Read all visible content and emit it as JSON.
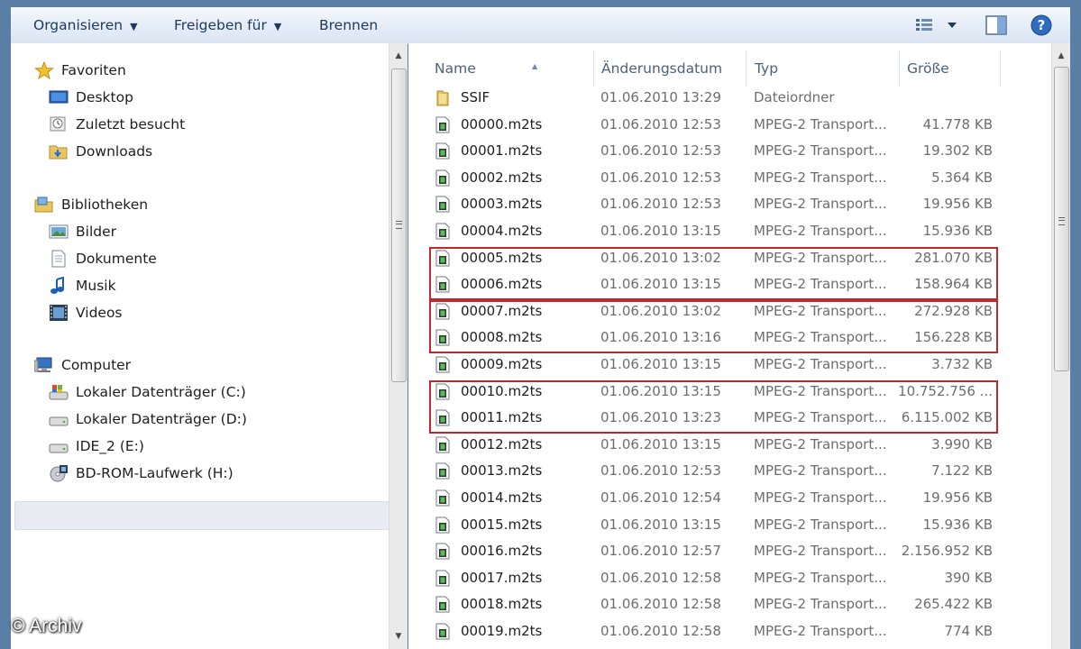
{
  "toolbar": {
    "organize": "Organisieren",
    "share": "Freigeben für",
    "burn": "Brennen"
  },
  "nav": {
    "favorites": {
      "label": "Favoriten",
      "items": [
        "Desktop",
        "Zuletzt besucht",
        "Downloads"
      ]
    },
    "libraries": {
      "label": "Bibliotheken",
      "items": [
        "Bilder",
        "Dokumente",
        "Musik",
        "Videos"
      ]
    },
    "computer": {
      "label": "Computer",
      "items": [
        "Lokaler Datenträger (C:)",
        "Lokaler Datenträger (D:)",
        "IDE_2 (E:)",
        "BD-ROM-Laufwerk (H:)"
      ]
    }
  },
  "columns": {
    "name": "Name",
    "date": "Änderungsdatum",
    "type": "Typ",
    "size": "Größe"
  },
  "files": [
    {
      "name": "SSIF",
      "date": "01.06.2010 13:29",
      "type": "Dateiordner",
      "size": "",
      "icon": "folder-icon"
    },
    {
      "name": "00000.m2ts",
      "date": "01.06.2010 12:53",
      "type": "MPEG-2 Transport...",
      "size": "41.778 KB",
      "icon": "video-file-icon"
    },
    {
      "name": "00001.m2ts",
      "date": "01.06.2010 12:53",
      "type": "MPEG-2 Transport...",
      "size": "19.302 KB",
      "icon": "video-file-icon"
    },
    {
      "name": "00002.m2ts",
      "date": "01.06.2010 12:53",
      "type": "MPEG-2 Transport...",
      "size": "5.364 KB",
      "icon": "video-file-icon"
    },
    {
      "name": "00003.m2ts",
      "date": "01.06.2010 12:53",
      "type": "MPEG-2 Transport...",
      "size": "19.956 KB",
      "icon": "video-file-icon"
    },
    {
      "name": "00004.m2ts",
      "date": "01.06.2010 13:15",
      "type": "MPEG-2 Transport...",
      "size": "15.936 KB",
      "icon": "video-file-icon"
    },
    {
      "name": "00005.m2ts",
      "date": "01.06.2010 13:02",
      "type": "MPEG-2 Transport...",
      "size": "281.070 KB",
      "icon": "video-file-icon"
    },
    {
      "name": "00006.m2ts",
      "date": "01.06.2010 13:15",
      "type": "MPEG-2 Transport...",
      "size": "158.964 KB",
      "icon": "video-file-icon"
    },
    {
      "name": "00007.m2ts",
      "date": "01.06.2010 13:02",
      "type": "MPEG-2 Transport...",
      "size": "272.928 KB",
      "icon": "video-file-icon"
    },
    {
      "name": "00008.m2ts",
      "date": "01.06.2010 13:16",
      "type": "MPEG-2 Transport...",
      "size": "156.228 KB",
      "icon": "video-file-icon"
    },
    {
      "name": "00009.m2ts",
      "date": "01.06.2010 13:15",
      "type": "MPEG-2 Transport...",
      "size": "3.732 KB",
      "icon": "video-file-icon"
    },
    {
      "name": "00010.m2ts",
      "date": "01.06.2010 13:15",
      "type": "MPEG-2 Transport...",
      "size": "10.752.756 ...",
      "icon": "video-file-icon"
    },
    {
      "name": "00011.m2ts",
      "date": "01.06.2010 13:23",
      "type": "MPEG-2 Transport...",
      "size": "6.115.002 KB",
      "icon": "video-file-icon"
    },
    {
      "name": "00012.m2ts",
      "date": "01.06.2010 13:15",
      "type": "MPEG-2 Transport...",
      "size": "3.990 KB",
      "icon": "video-file-icon"
    },
    {
      "name": "00013.m2ts",
      "date": "01.06.2010 12:53",
      "type": "MPEG-2 Transport...",
      "size": "7.122 KB",
      "icon": "video-file-icon"
    },
    {
      "name": "00014.m2ts",
      "date": "01.06.2010 12:54",
      "type": "MPEG-2 Transport...",
      "size": "19.956 KB",
      "icon": "video-file-icon"
    },
    {
      "name": "00015.m2ts",
      "date": "01.06.2010 13:15",
      "type": "MPEG-2 Transport...",
      "size": "15.936 KB",
      "icon": "video-file-icon"
    },
    {
      "name": "00016.m2ts",
      "date": "01.06.2010 12:57",
      "type": "MPEG-2 Transport...",
      "size": "2.156.952 KB",
      "icon": "video-file-icon"
    },
    {
      "name": "00017.m2ts",
      "date": "01.06.2010 12:58",
      "type": "MPEG-2 Transport...",
      "size": "390 KB",
      "icon": "video-file-icon"
    },
    {
      "name": "00018.m2ts",
      "date": "01.06.2010 12:58",
      "type": "MPEG-2 Transport...",
      "size": "265.422 KB",
      "icon": "video-file-icon"
    },
    {
      "name": "00019.m2ts",
      "date": "01.06.2010 12:58",
      "type": "MPEG-2 Transport...",
      "size": "774 KB",
      "icon": "video-file-icon"
    }
  ],
  "highlight_color": "#c1272d",
  "watermark": "© Archiv"
}
